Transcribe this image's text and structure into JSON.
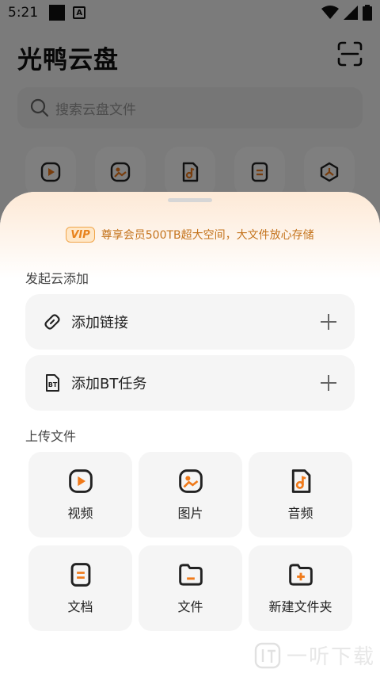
{
  "status_bar": {
    "time": "5:21",
    "app_indicator": "A"
  },
  "header": {
    "title": "光鸭云盘"
  },
  "search": {
    "placeholder": "搜索云盘文件"
  },
  "quick_icons": [
    "video-icon",
    "image-icon",
    "music-icon",
    "document-icon",
    "torrent-icon"
  ],
  "promo": {
    "badge": "VIP",
    "text": "尊享会员500TB超大空间，大文件放心存储"
  },
  "cloud_add": {
    "label": "发起云添加",
    "items": [
      {
        "label": "添加链接",
        "icon": "link-icon"
      },
      {
        "label": "添加BT任务",
        "icon": "bt-file-icon"
      }
    ]
  },
  "upload": {
    "label": "上传文件",
    "items": [
      {
        "label": "视频",
        "icon": "video-icon"
      },
      {
        "label": "图片",
        "icon": "image-icon"
      },
      {
        "label": "音频",
        "icon": "music-icon"
      },
      {
        "label": "文档",
        "icon": "document-icon"
      },
      {
        "label": "文件",
        "icon": "folder-icon"
      },
      {
        "label": "新建文件夹",
        "icon": "new-folder-icon"
      }
    ]
  },
  "watermark": {
    "text": "一听下载"
  },
  "colors": {
    "accent": "#f07a1a",
    "icon_dark": "#222222",
    "sheet_bg": "#ffffff",
    "card_bg": "#f5f5f5"
  }
}
